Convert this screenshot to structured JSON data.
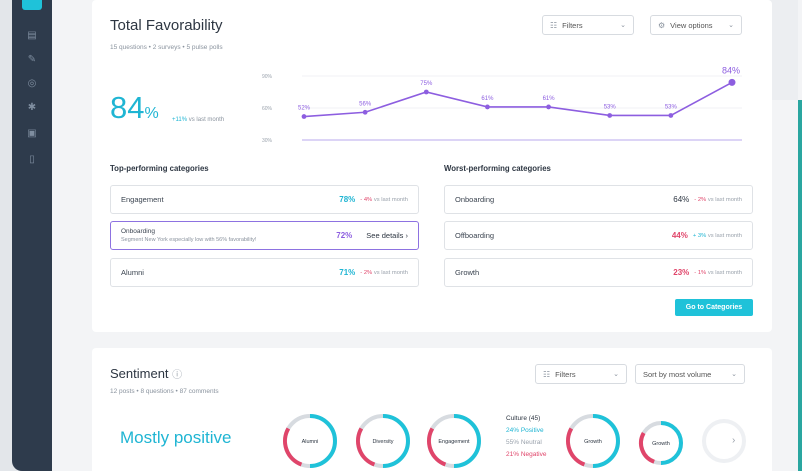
{
  "favorability": {
    "title": "Total Favorability",
    "subtitle": "15 questions • 2 surveys • 5 pulse polls",
    "filters_label": "Filters",
    "view_options_label": "View options",
    "big_value": "84",
    "big_unit": "%",
    "delta_value": "+11%",
    "delta_text": "vs last month",
    "chart_data": {
      "type": "line",
      "y_ticks": [
        "90%",
        "60%",
        "30%"
      ],
      "values": [
        52,
        56,
        75,
        61,
        61,
        53,
        53,
        84
      ],
      "labels": [
        "52%",
        "56%",
        "75%",
        "61%",
        "61%",
        "53%",
        "53%",
        "84%"
      ],
      "ylim": [
        30,
        90
      ],
      "color": "#8d5ee0"
    },
    "top_heading": "Top-performing categories",
    "worst_heading": "Worst-performing categories",
    "top": [
      {
        "name": "Engagement",
        "pct": "78%",
        "delta": "- 4%",
        "cmp": "vs last month"
      },
      {
        "name": "Onboarding",
        "note": "Segment New York especially low with 56% favorability!",
        "pct": "72%",
        "action": "See details"
      },
      {
        "name": "Alumni",
        "pct": "71%",
        "delta": "- 2%",
        "cmp": "vs last month"
      }
    ],
    "worst": [
      {
        "name": "Onboarding",
        "pct": "64%",
        "delta": "- 2%",
        "cmp": "vs last month"
      },
      {
        "name": "Offboarding",
        "pct": "44%",
        "delta": "+ 3%",
        "cmp": "vs last month"
      },
      {
        "name": "Growth",
        "pct": "23%",
        "delta": "- 1%",
        "cmp": "vs last month"
      }
    ],
    "go_button": "Go to Categories"
  },
  "sentiment": {
    "title": "Sentiment",
    "subtitle": "12 posts • 8 questions • 87 comments",
    "filters_label": "Filters",
    "sort_label": "Sort by most volume",
    "headline": "Mostly positive",
    "donuts": [
      "Alumni",
      "Diversity",
      "Engagement",
      "Growth",
      "Growth"
    ],
    "culture": {
      "title": "Culture (45)",
      "positive": "24% Positive",
      "neutral": "55% Neutral",
      "negative": "21% Negative"
    }
  },
  "colors": {
    "accent": "#1fc2d9",
    "purple": "#8d5ee0",
    "negative": "#e0456a",
    "sidebar": "#2e3b4c"
  }
}
